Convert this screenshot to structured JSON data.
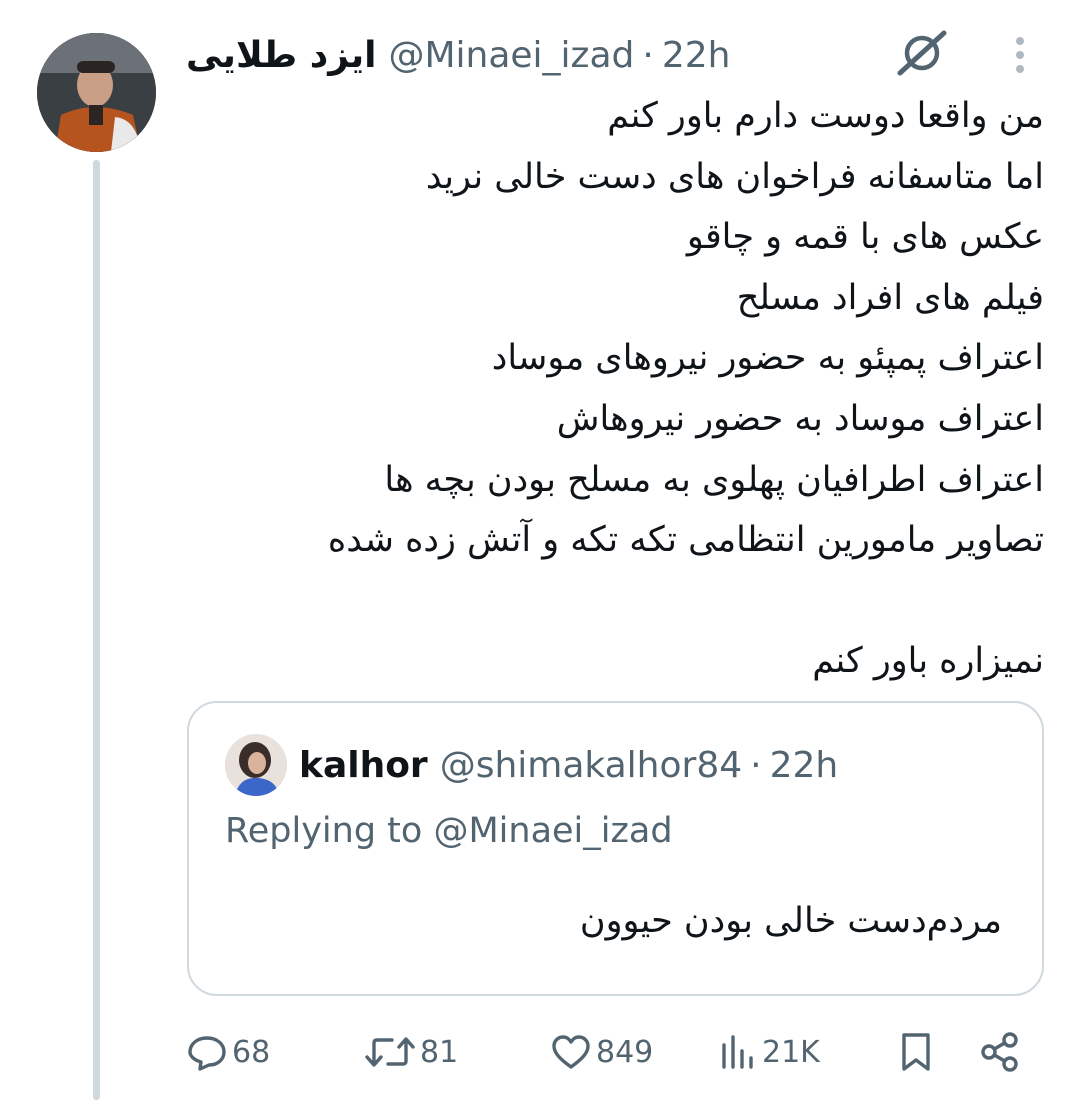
{
  "tweet": {
    "display_name": "ایزد طلایی",
    "handle": "@Minaei_izad",
    "separator": "·",
    "time": "22h",
    "body_lines": [
      "من واقعا دوست دارم باور کنم",
      "اما متاسفانه فراخوان های دست خالی نرید",
      "عکس های با قمه و چاقو",
      "فیلم های افراد مسلح",
      "اعتراف پمپئو به حضور نیروهای موساد",
      "اعتراف موساد به حضور نیروهاش",
      "اعتراف اطرافیان پهلوی به مسلح بودن بچه ها",
      "تصاویر مامورین انتظامی تکه تکه و آتش زده شده"
    ],
    "body_last": "نمیزاره باور کنم"
  },
  "quote": {
    "display_name": "kalhor",
    "handle": "@shimakalhor84",
    "separator": "·",
    "time": "22h",
    "replying_prefix": "Replying to",
    "replying_to": "@Minaei_izad",
    "text": "مردم‌دست خالی بودن حیوون"
  },
  "actions": {
    "replies": "68",
    "reposts": "81",
    "likes": "849",
    "views": "21K"
  },
  "icons": {
    "grok": "grok-slash-icon",
    "more": "more-vertical-icon",
    "reply": "reply-bubble-icon",
    "repost": "repost-arrows-icon",
    "like": "heart-icon",
    "views": "views-bars-icon",
    "bookmark": "bookmark-icon",
    "share": "share-icon"
  },
  "colors": {
    "text": "#0f1419",
    "secondary": "#536471",
    "border": "#cfd9de"
  }
}
